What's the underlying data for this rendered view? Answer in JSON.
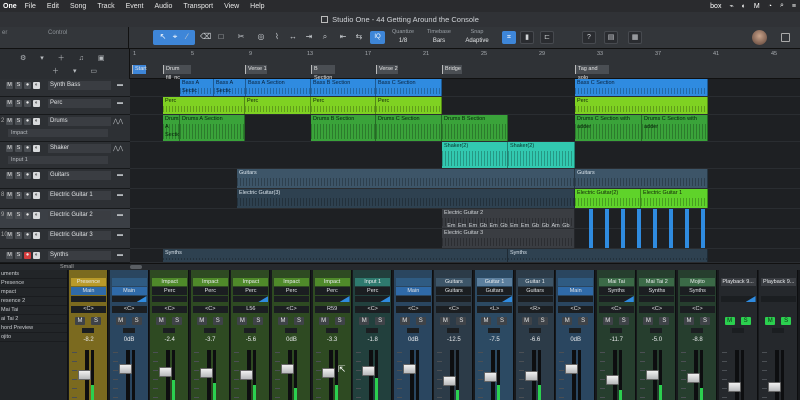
{
  "menubar": {
    "app": "One",
    "items": [
      "File",
      "Edit",
      "Song",
      "Track",
      "Event",
      "Audio",
      "Transport",
      "View",
      "Help"
    ],
    "right": [
      "box",
      "⌁",
      "◐",
      "M",
      "◔",
      "⌕",
      "≡"
    ]
  },
  "window": {
    "title": "Studio One - 44 Getting Around the Console"
  },
  "toolbar": {
    "field1_label": "er",
    "field2_label": "Control",
    "tools": [
      "↖",
      "⌖",
      "∕",
      "⌫",
      "□",
      "✂",
      "◎",
      "⌇",
      "↔",
      "⇥",
      "⌕",
      "⇤",
      "⇆"
    ],
    "iq": "IQ",
    "quantize_label": "Quantize",
    "quantize_value": "1/8",
    "timebase_label": "Timebase",
    "timebase_value": "Bars",
    "snap_label": "Snap",
    "snap_value": "Adaptive",
    "right_btns": [
      "⌗",
      "▮",
      "⊏",
      "?",
      "▤",
      "▦"
    ]
  },
  "ruler": {
    "bars": [
      "1",
      "5",
      "9",
      "13",
      "17",
      "21",
      "25",
      "29",
      "33",
      "37",
      "41",
      "45"
    ],
    "markers": [
      "Start",
      "Drum fill_nc",
      "Verse 1",
      "B Section",
      "Verse 2",
      "Bridge",
      "Tag and solo"
    ]
  },
  "tracks": [
    {
      "num": "",
      "name": "Synth Bass",
      "sub": "",
      "color": "#2f8be0"
    },
    {
      "num": "",
      "name": "Perc",
      "sub": "",
      "color": "#7fd122"
    },
    {
      "num": "2",
      "name": "Drums",
      "sub": "Impact",
      "color": "#3aa33a"
    },
    {
      "num": "",
      "name": "Shaker",
      "sub": "Input 1",
      "color": "#32c9b0"
    },
    {
      "num": "",
      "name": "Guitars",
      "sub": "",
      "color": "#3d5568"
    },
    {
      "num": "8",
      "name": "Electric Guitar 1",
      "sub": "",
      "color": "#3d5568"
    },
    {
      "num": "9",
      "name": "Electric Guitar 2",
      "sub": "",
      "color": "#3d5568"
    },
    {
      "num": "10",
      "name": "Electric Guitar 3",
      "sub": "",
      "color": "#3d5568"
    },
    {
      "num": "",
      "name": "Synths",
      "sub": "",
      "color": "#3d5568"
    }
  ],
  "lanes": {
    "synth_bass": [
      "Bass A Sectic",
      "Bass A Sectic",
      "Bass A Section",
      "Bass B Section",
      "Bass C Section",
      "Bass C Section"
    ],
    "perc": [
      "Perc",
      "Perc",
      "Perc",
      "Perc",
      "Perc"
    ],
    "drums": [
      "Drums A Section",
      "Drums A Section",
      "Drums B Section",
      "Drums C Section",
      "Drums B Section",
      "Drums C Section with adder",
      "Drums C Section with adder"
    ],
    "shaker": [
      "Shaker(2)",
      "Shaker(2)"
    ],
    "guitars": [
      "Guitars",
      "Guitars"
    ],
    "eg1": [
      "Electric Guitar(3)",
      "Electric Guitar(2)",
      "Electric Guitar 1",
      "Electric Guitar 1"
    ],
    "eg2": [
      "Electric Guitar 2"
    ],
    "chords": [
      "Em",
      "Em",
      "Em",
      "Gb",
      "Em",
      "Gb",
      "Em",
      "Em",
      "Gb",
      "Gb",
      "Am",
      "Gb"
    ],
    "eg3": [
      "Electric Guitar 3"
    ],
    "synths": [
      "Synths",
      "Synths"
    ]
  },
  "smallbar_label": "Small",
  "console": {
    "instruments": [
      "uments",
      "Presence",
      "mpact",
      "resence 2",
      "Mai Tai",
      "ai Tai 2",
      "hord Preview",
      "ojito"
    ],
    "strips": [
      {
        "name": "Presence",
        "io": "Main",
        "pan": "<C>",
        "db": "-8.2",
        "color": "#7b6a1f",
        "ncolor": "#b99a2a",
        "fader": 0.55,
        "meter": 0.3
      },
      {
        "name": "",
        "io": "Main",
        "pan": "<C>",
        "db": "0dB",
        "color": "#2a4660",
        "ncolor": "#2f5b82",
        "fader": 0.7,
        "meter": 0.0
      },
      {
        "name": "Impact",
        "io": "Perc",
        "pan": "<C>",
        "db": "-2.4",
        "color": "#2e4a22",
        "ncolor": "#4f8a2a",
        "fader": 0.62,
        "meter": 0.4
      },
      {
        "name": "Impact",
        "io": "Perc",
        "pan": "<C>",
        "db": "-3.7",
        "color": "#2e4a22",
        "ncolor": "#4f8a2a",
        "fader": 0.6,
        "meter": 0.35
      },
      {
        "name": "Impact",
        "io": "Perc",
        "pan": "L56",
        "db": "-5.6",
        "color": "#2e4a22",
        "ncolor": "#4f8a2a",
        "fader": 0.56,
        "meter": 0.3
      },
      {
        "name": "Impact",
        "io": "Perc",
        "pan": "<C>",
        "db": "0dB",
        "color": "#2e4a22",
        "ncolor": "#4f8a2a",
        "fader": 0.7,
        "meter": 0.25
      },
      {
        "name": "Impact",
        "io": "Perc",
        "pan": "R59",
        "db": "-3.3",
        "color": "#2e4a22",
        "ncolor": "#4f8a2a",
        "fader": 0.6,
        "meter": 0.3
      },
      {
        "name": "Input 1",
        "io": "Perc",
        "pan": "<C>",
        "db": "-1.8",
        "color": "#22403d",
        "ncolor": "#2e7a6e",
        "fader": 0.65,
        "meter": 0.45
      },
      {
        "name": "",
        "io": "Main",
        "pan": "<C>",
        "db": "0dB",
        "color": "#2a4660",
        "ncolor": "#2f5b82",
        "fader": 0.7,
        "meter": 0.0
      },
      {
        "name": "Guitars",
        "io": "Guitars",
        "pan": "<C>",
        "db": "-12.5",
        "color": "#2c3b48",
        "ncolor": "#3d5568",
        "fader": 0.42,
        "meter": 0.2
      },
      {
        "name": "Guitar 1",
        "io": "Guitars",
        "pan": "<L>",
        "db": "-7.5",
        "color": "#2c4a63",
        "ncolor": "#5b7f9e",
        "fader": 0.52,
        "meter": 0.3
      },
      {
        "name": "Guitar 1",
        "io": "Guitars",
        "pan": "<R>",
        "db": "-6.6",
        "color": "#2c3b48",
        "ncolor": "#3d5568",
        "fader": 0.53,
        "meter": 0.3
      },
      {
        "name": "",
        "io": "Main",
        "pan": "<C>",
        "db": "0dB",
        "color": "#2a4660",
        "ncolor": "#2f5b82",
        "fader": 0.7,
        "meter": 0.0
      },
      {
        "name": "Mai Tai",
        "io": "Synths",
        "pan": "<C>",
        "db": "-11.7",
        "color": "#263e2e",
        "ncolor": "#3b6a47",
        "fader": 0.44,
        "meter": 0.2
      },
      {
        "name": "Mai Tai 2",
        "io": "Synths",
        "pan": "<C>",
        "db": "-5.0",
        "color": "#263e2e",
        "ncolor": "#3b6a47",
        "fader": 0.56,
        "meter": 0.3
      },
      {
        "name": "Mojito",
        "io": "Synths",
        "pan": "<C>",
        "db": "-8.8",
        "color": "#263e2e",
        "ncolor": "#3b6a47",
        "fader": 0.5,
        "meter": 0.25
      },
      {
        "name": "Playback 9...",
        "io": "",
        "pan": "",
        "db": "",
        "color": "#25282c",
        "ncolor": "#3a3d42",
        "fader": 0.0,
        "meter": 0.0
      },
      {
        "name": "Playback 9...",
        "io": "",
        "pan": "",
        "db": "",
        "color": "#25282c",
        "ncolor": "#3a3d42",
        "fader": 0.0,
        "meter": 0.0
      }
    ]
  }
}
